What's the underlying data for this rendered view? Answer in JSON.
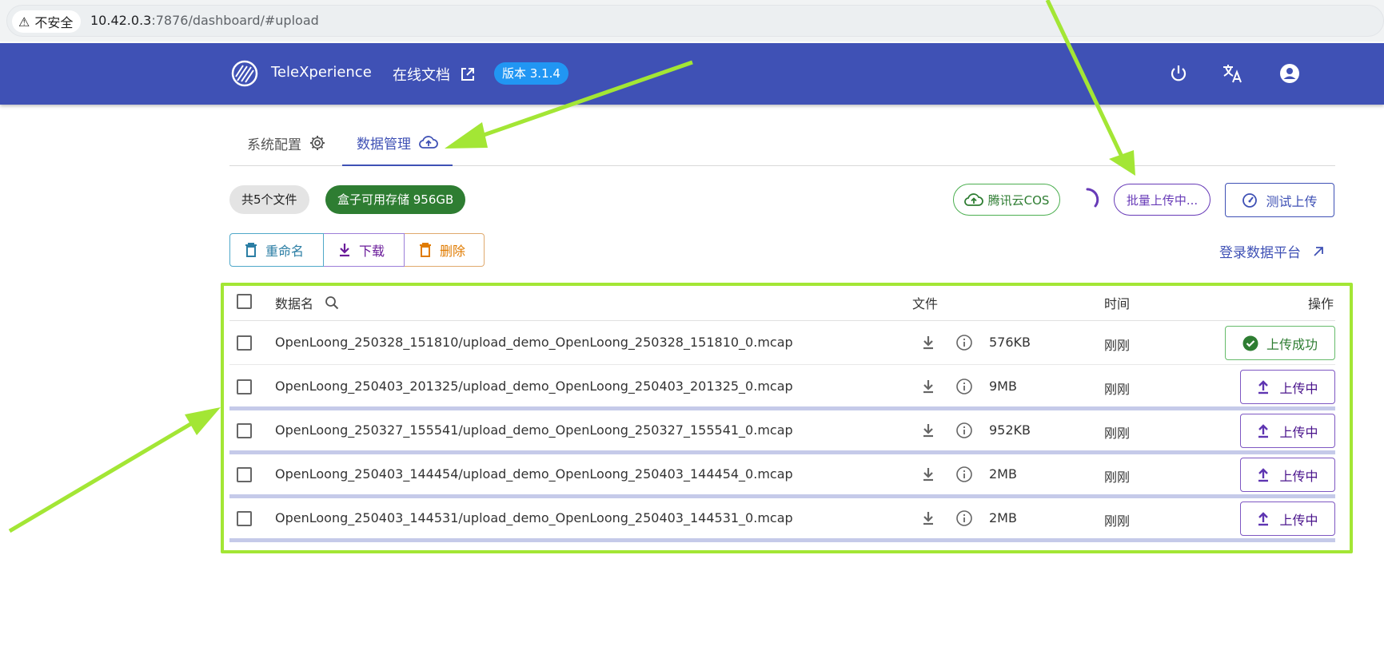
{
  "browser": {
    "security_label": "不安全",
    "url_host": "10.42.0.3",
    "url_rest": ":7876/dashboard/#upload"
  },
  "header": {
    "brand": "TeleXperience",
    "docs_label": "在线文档",
    "version": "版本 3.1.4",
    "icons": [
      "power-icon",
      "translate-icon",
      "account-icon"
    ]
  },
  "tabs": [
    {
      "label": "系统配置",
      "icon": "gear-icon",
      "active": false
    },
    {
      "label": "数据管理",
      "icon": "cloud-upload-icon",
      "active": true
    }
  ],
  "toolbar": {
    "file_count": "共5个文件",
    "storage": "盒子可用存储 956GB",
    "cos_label": "腾讯云COS",
    "batch_label": "批量上传中...",
    "test_label": "测试上传",
    "rename_label": "重命名",
    "download_label": "下载",
    "delete_label": "删除",
    "login_label": "登录数据平台"
  },
  "table": {
    "headers": {
      "name": "数据名",
      "file": "文件",
      "time": "时间",
      "action": "操作"
    },
    "rows": [
      {
        "name": "OpenLoong_250328_151810/upload_demo_OpenLoong_250328_151810_0.mcap",
        "size": "576KB",
        "time": "刚刚",
        "action": "上传成功",
        "status": "success"
      },
      {
        "name": "OpenLoong_250403_201325/upload_demo_OpenLoong_250403_201325_0.mcap",
        "size": "9MB",
        "time": "刚刚",
        "action": "上传中",
        "status": "uploading"
      },
      {
        "name": "OpenLoong_250327_155541/upload_demo_OpenLoong_250327_155541_0.mcap",
        "size": "952KB",
        "time": "刚刚",
        "action": "上传中",
        "status": "uploading"
      },
      {
        "name": "OpenLoong_250403_144454/upload_demo_OpenLoong_250403_144454_0.mcap",
        "size": "2MB",
        "time": "刚刚",
        "action": "上传中",
        "status": "uploading"
      },
      {
        "name": "OpenLoong_250403_144531/upload_demo_OpenLoong_250403_144531_0.mcap",
        "size": "2MB",
        "time": "刚刚",
        "action": "上传中",
        "status": "uploading"
      }
    ]
  },
  "colors": {
    "header_bg": "#3f51b5",
    "annotation": "#a3e635",
    "success": "#2e7d32",
    "uploading": "#673ab7"
  }
}
